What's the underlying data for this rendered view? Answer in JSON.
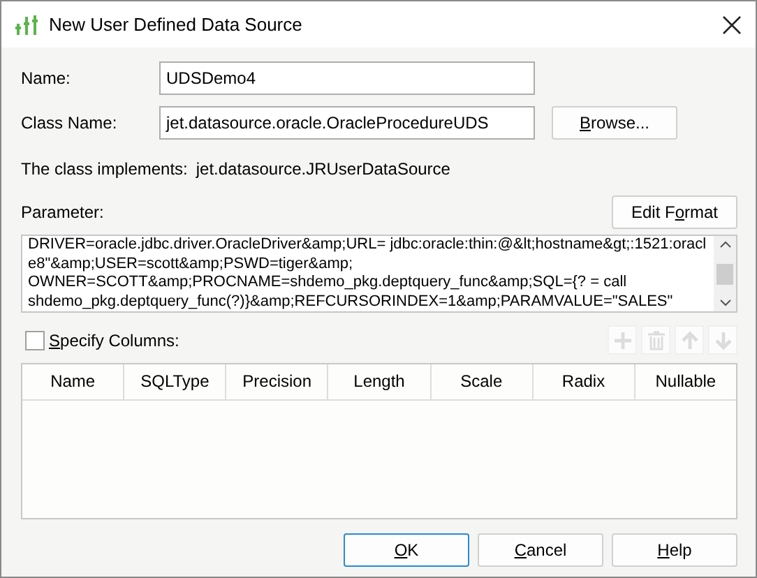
{
  "window": {
    "title": "New User Defined Data Source"
  },
  "name_field": {
    "label": "Name:",
    "value": "UDSDemo4"
  },
  "class_field": {
    "label": "Class Name:",
    "value": "jet.datasource.oracle.OracleProcedureUDS"
  },
  "browse_button": {
    "key": "B",
    "post": "rowse..."
  },
  "implements": {
    "label": "The class implements:",
    "value": "jet.datasource.JRUserDataSource"
  },
  "parameter": {
    "label": "Parameter:",
    "lines": [
      "DRIVER=oracle.jdbc.driver.OracleDriver&amp;URL= jdbc:oracle:thin:@&lt;hostname&gt;:1521:oracl",
      "e8\"&amp;USER=scott&amp;PSWD=tiger&amp;",
      "OWNER=SCOTT&amp;PROCNAME=shdemo_pkg.deptquery_func&amp;SQL={? = call",
      "shdemo_pkg.deptquery_func(?)}&amp;REFCURSORINDEX=1&amp;PARAMVALUE=\"SALES\""
    ]
  },
  "edit_format_button": {
    "pre": "Edit F",
    "key": "o",
    "post": "rmat"
  },
  "specify_columns": {
    "key": "S",
    "post": "pecify Columns:",
    "checked": false
  },
  "column_tools": [
    {
      "kind": "add",
      "disabled": true
    },
    {
      "kind": "delete",
      "disabled": true
    },
    {
      "kind": "up",
      "disabled": true
    },
    {
      "kind": "down",
      "disabled": true
    }
  ],
  "table": {
    "columns": [
      "Name",
      "SQLType",
      "Precision",
      "Length",
      "Scale",
      "Radix",
      "Nullable"
    ]
  },
  "buttons": [
    {
      "key": "O",
      "post": "K",
      "default": true
    },
    {
      "key": "C",
      "post": "ancel",
      "default": false
    },
    {
      "key": "H",
      "post": "elp",
      "default": false
    }
  ]
}
